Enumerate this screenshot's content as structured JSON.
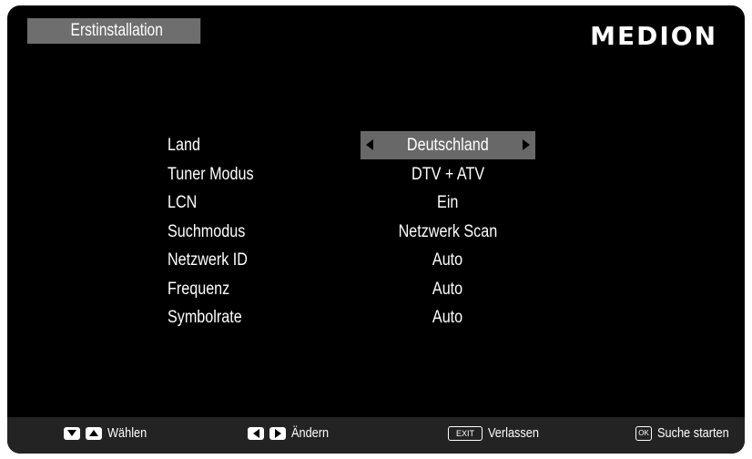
{
  "header": {
    "title": "Erstinstallation",
    "brand": "MEDION"
  },
  "settings": [
    {
      "label": "Land",
      "value": "Deutschland",
      "selected": true
    },
    {
      "label": "Tuner Modus",
      "value": "DTV + ATV"
    },
    {
      "label": "LCN",
      "value": "Ein"
    },
    {
      "label": "Suchmodus",
      "value": "Netzwerk Scan"
    },
    {
      "label": "Netzwerk ID",
      "value": "Auto"
    },
    {
      "label": "Frequenz",
      "value": "Auto"
    },
    {
      "label": "Symbolrate",
      "value": "Auto"
    }
  ],
  "footer": {
    "select": "Wählen",
    "change": "Ändern",
    "exit_key": "EXIT",
    "exit": "Verlassen",
    "ok_key": "OK",
    "start": "Suche starten"
  }
}
